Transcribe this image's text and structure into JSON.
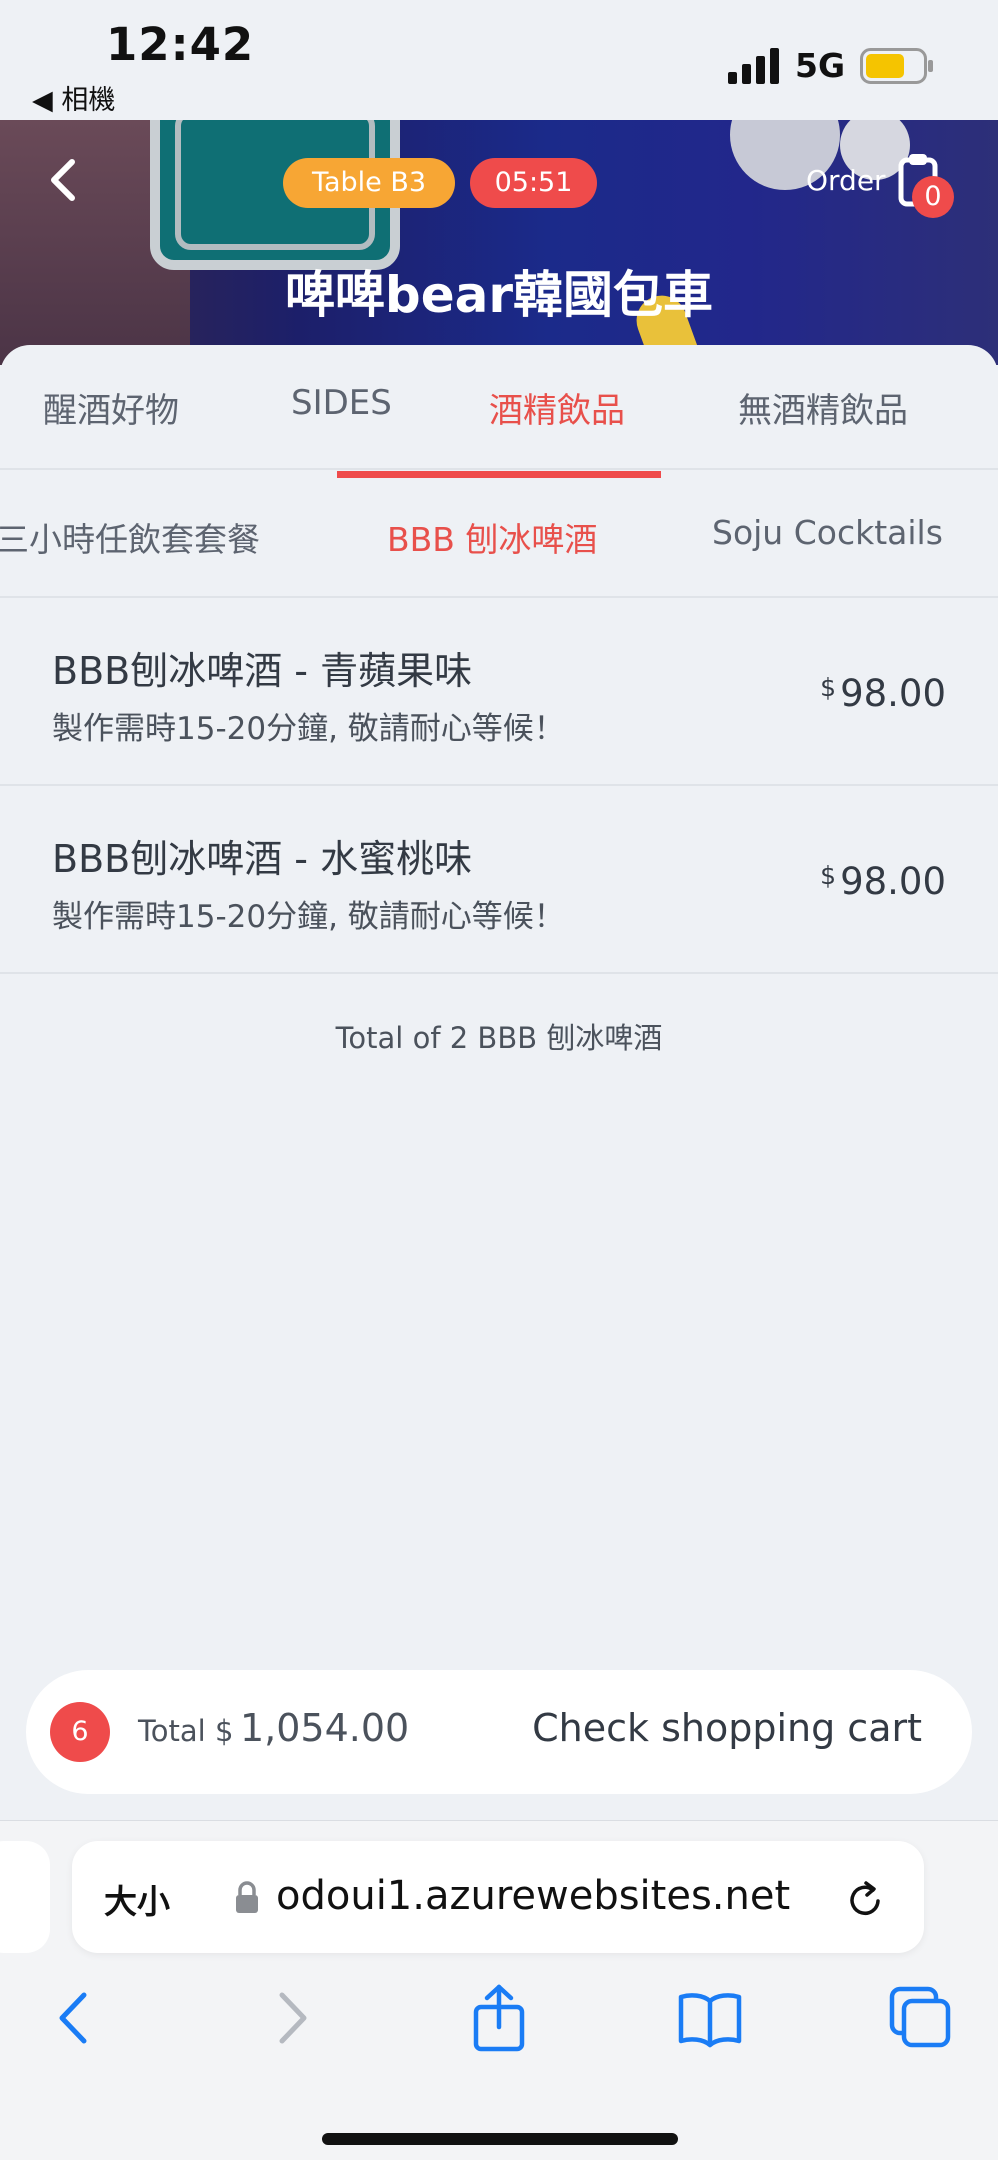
{
  "status_bar": {
    "time": "12:42",
    "back_app": "◀ 相機",
    "network": "5G",
    "signal_icon": "signal-bars-icon",
    "battery_icon": "battery-icon",
    "battery_color": "#f5c400"
  },
  "header": {
    "table_badge": "Table  B3",
    "timer": "05:51",
    "order_label": "Order",
    "order_count": "0",
    "store_title": "啤啤bear韓國包車",
    "colors": {
      "table_badge": "#f7a634",
      "timer_badge": "#ef4b4b",
      "accent": "#ef4b4b"
    }
  },
  "category_tabs": [
    {
      "label": "醒酒好物",
      "active": false
    },
    {
      "label": "SIDES",
      "active": false
    },
    {
      "label": "酒精飲品",
      "active": true
    },
    {
      "label": "無酒精飲品",
      "active": false
    }
  ],
  "sub_tabs": [
    {
      "label": "三小時任飲套套餐",
      "active": false
    },
    {
      "label": "BBB 刨冰啤酒",
      "active": true
    },
    {
      "label": "Soju Cocktails",
      "active": false
    }
  ],
  "products": [
    {
      "name": "BBB刨冰啤酒 - 青蘋果味",
      "description": "製作需時15-20分鐘, 敬請耐心等候！",
      "currency": "$",
      "price": "98.00"
    },
    {
      "name": "BBB刨冰啤酒 - 水蜜桃味",
      "description": "製作需時15-20分鐘, 敬請耐心等候！",
      "currency": "$",
      "price": "98.00"
    }
  ],
  "list_total": "Total of 2 BBB 刨冰啤酒",
  "cart": {
    "count": "6",
    "total_label": "Total $",
    "total_value": "1,054.00",
    "check_label": "Check shopping cart"
  },
  "browser": {
    "text_size_label": "大小",
    "url": "odoui1.azurewebsites.net",
    "accent_color": "#1a7cf5"
  }
}
